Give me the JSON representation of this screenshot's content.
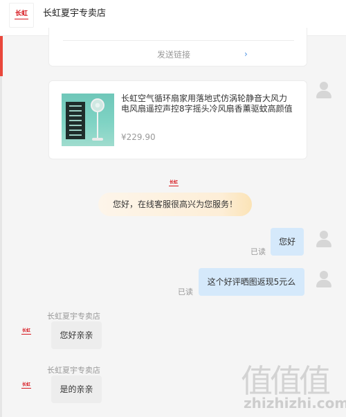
{
  "header": {
    "logo_text": "长虹",
    "store_name": "长虹夏宇专卖店"
  },
  "send_card": {
    "link_label": "发送链接",
    "arrow": "›"
  },
  "product": {
    "title": "长虹空气循环扇家用落地式仿涡轮静音大风力电风扇遥控声控8字摇头冷风扇香薰驱蚊高颜值新...",
    "price": "¥229.90"
  },
  "welcome": {
    "logo_text": "长虹",
    "message": "您好，在线客服很高兴为您服务！"
  },
  "messages": [
    {
      "side": "right",
      "text": "您好",
      "status": "已读"
    },
    {
      "side": "right",
      "text": "这个好评晒图返现5元么",
      "status": "已读"
    },
    {
      "side": "left",
      "sender": "长虹夏宇专卖店",
      "logo_text": "长虹",
      "text": "您好亲亲"
    },
    {
      "side": "left",
      "sender": "长虹夏宇专卖店",
      "logo_text": "长虹",
      "text": "是的亲亲"
    }
  ],
  "watermark": {
    "chars": "值值值",
    "domain": "zhizhizhi.com"
  },
  "colors": {
    "accent_red": "#e9473c",
    "user_bubble": "#d5e9fb",
    "seller_bubble": "#ededed",
    "link_blue": "#4a90e2"
  }
}
